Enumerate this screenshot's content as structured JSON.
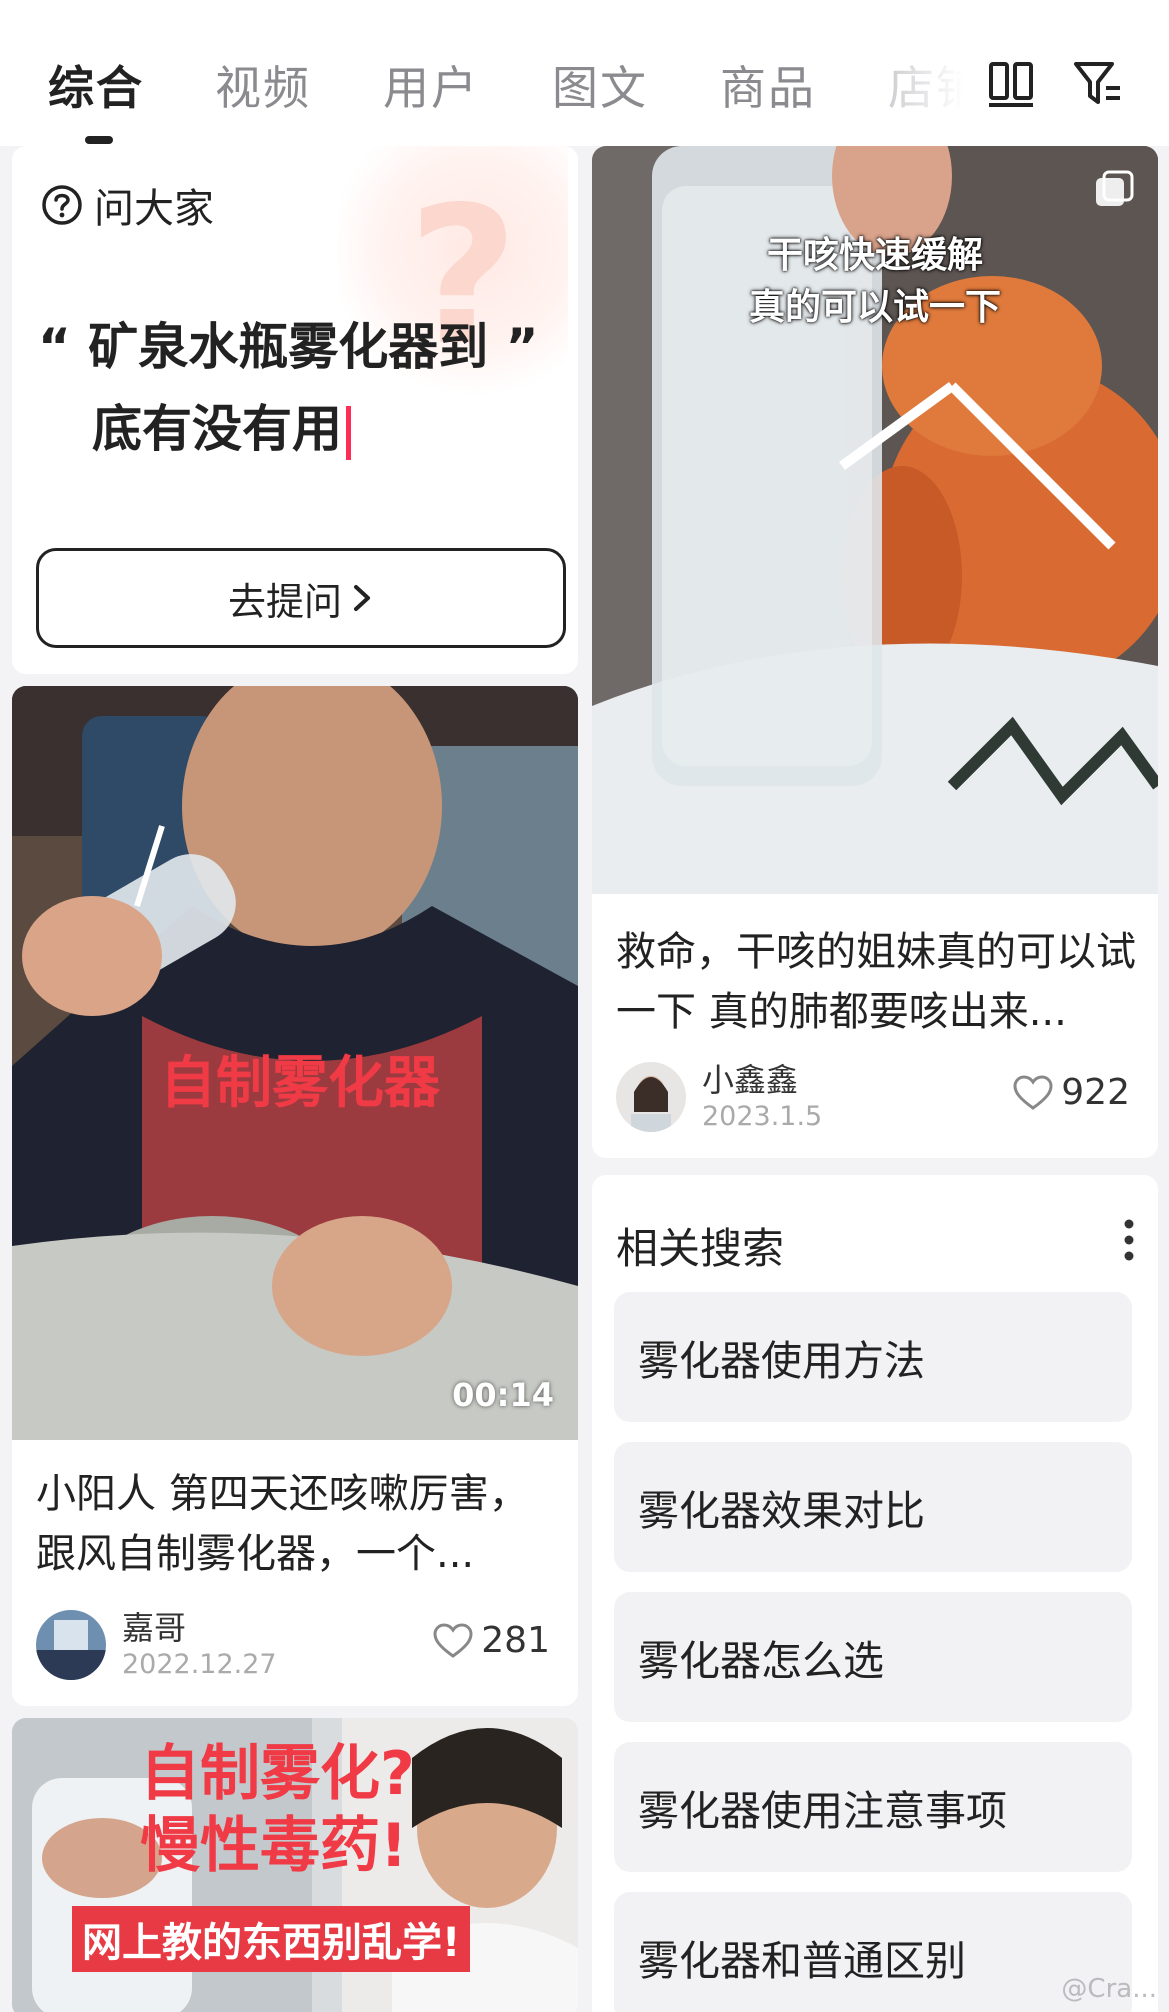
{
  "tabs": [
    {
      "label": "综合",
      "active": true
    },
    {
      "label": "视频",
      "active": false
    },
    {
      "label": "用户",
      "active": false
    },
    {
      "label": "图文",
      "active": false
    },
    {
      "label": "商品",
      "active": false
    },
    {
      "label": "店铺",
      "active": false
    }
  ],
  "toolbar": {
    "layout_icon": "double-column-icon",
    "filter_icon": "filter-icon"
  },
  "ask_card": {
    "header": "问大家",
    "title_line1": "“ 矿泉水瓶雾化器到 ”",
    "title_line2": "底有没有用",
    "button_label": "去提问"
  },
  "posts": [
    {
      "overlay": "自制雾化器",
      "duration": "00:14",
      "title": "小阳人 第四天还咳嗽厉害，跟风自制雾化器，一个...",
      "author": "嘉哥",
      "date": "2022.12.27",
      "likes": "281"
    },
    {
      "overlay_line1": "干咳快速缓解",
      "overlay_line2": "真的可以试一下",
      "title": "救命，干咳的姐妹真的可以试一下 真的肺都要咳出来...",
      "author": "小鑫鑫",
      "date": "2023.1.5",
      "likes": "922"
    },
    {
      "overlay_line1": "自制雾化?",
      "overlay_line2": "慢性毒药!",
      "overlay_line3": "网上教的东西别乱学!"
    }
  ],
  "related": {
    "title": "相关搜索",
    "items": [
      "雾化器使用方法",
      "雾化器效果对比",
      "雾化器怎么选",
      "雾化器使用注意事项",
      "雾化器和普通区别"
    ]
  },
  "watermark": "@Cra...",
  "colors": {
    "accent": "#ff2d55",
    "overlay_red": "#f03a45",
    "tab_inactive": "#8a8a8f"
  }
}
